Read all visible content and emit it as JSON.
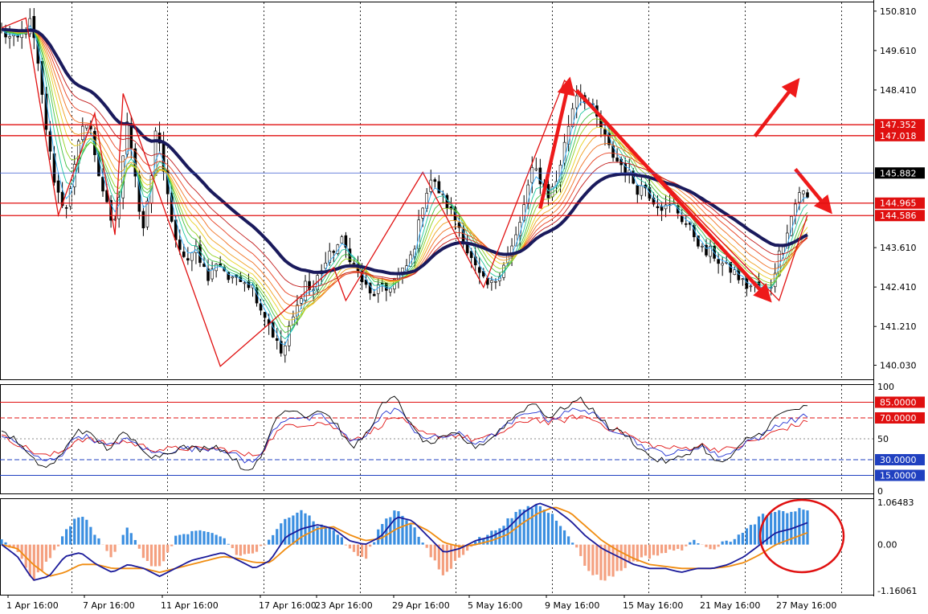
{
  "chart_data": [
    {
      "type": "candlestick",
      "title": "",
      "price_ticks": [
        "150.810",
        "149.610",
        "148.410",
        "147.352",
        "147.018",
        "145.882",
        "144.965",
        "144.586",
        "143.610",
        "142.410",
        "141.210",
        "140.030"
      ],
      "ylim": [
        139.6,
        151.1
      ],
      "date_ticks": [
        "1 Apr 16:00",
        "7 Apr 16:00",
        "11 Apr 16:00",
        "17 Apr 16:00",
        "23 Apr 16:00",
        "29 Apr 16:00",
        "5 May 16:00",
        "9 May 16:00",
        "15 May 16:00",
        "21 May 16:00",
        "27 May 16:00"
      ],
      "horizontal_levels": [
        {
          "value": 147.352,
          "label": "147.352",
          "color": "#e01010"
        },
        {
          "value": 147.018,
          "label": "147.018",
          "color": "#e01010"
        },
        {
          "value": 145.882,
          "label": "145.882",
          "color": "#3a5bd0",
          "current": true
        },
        {
          "value": 144.965,
          "label": "144.965",
          "color": "#e01010"
        },
        {
          "value": 144.586,
          "label": "144.586",
          "color": "#e01010"
        }
      ],
      "zigzag_points": [
        [
          0,
          150.3
        ],
        [
          4,
          150.6
        ],
        [
          10,
          144.6
        ],
        [
          16,
          147.7
        ],
        [
          20,
          144.0
        ],
        [
          21,
          148.3
        ],
        [
          38,
          140.0
        ],
        [
          58,
          143.0
        ],
        [
          60,
          142.0
        ],
        [
          73,
          145.9
        ],
        [
          84,
          142.4
        ],
        [
          98,
          148.7
        ],
        [
          135,
          142.0
        ],
        [
          140,
          144.6
        ]
      ],
      "key_close": [
        150.2,
        150.0,
        149.9,
        150.2,
        150.5,
        149.0,
        147.3,
        145.8,
        145.0,
        144.9,
        146.2,
        147.5,
        147.2,
        146.0,
        145.1,
        144.1,
        145.3,
        147.6,
        146.0,
        144.0,
        145.2,
        147.5,
        145.8,
        144.3,
        143.6,
        143.0,
        143.8,
        143.2,
        142.6,
        143.2,
        143.0,
        142.5,
        142.8,
        142.6,
        142.4,
        141.8,
        141.4,
        140.8,
        140.3,
        141.2,
        141.8,
        142.6,
        142.2,
        142.9,
        143.2,
        143.6,
        143.8,
        143.4,
        142.9,
        142.5,
        142.1,
        142.4,
        142.3,
        142.6,
        142.8,
        143.1,
        143.8,
        145.0,
        145.7,
        145.4,
        145.0,
        144.6,
        144.2,
        143.5,
        143.0,
        142.6,
        142.4,
        142.7,
        143.2,
        143.6,
        144.2,
        145.3,
        146.1,
        145.6,
        145.2,
        145.6,
        146.6,
        147.7,
        148.5,
        148.1,
        147.8,
        147.3,
        146.7,
        146.3,
        146.1,
        145.8,
        145.4,
        145.5,
        145.1,
        144.9,
        144.8,
        144.9,
        144.5,
        144.2,
        143.9,
        143.4,
        143.5,
        143.2,
        143.0,
        142.9,
        142.6,
        142.4,
        142.5,
        142.2,
        142.4,
        143.3,
        144.0,
        144.7,
        145.4,
        145.1
      ],
      "legend": "none",
      "grid": "vertical dotted"
    },
    {
      "type": "line",
      "name": "oscillator",
      "ylim": [
        0,
        100
      ],
      "y_ticks": [
        "100",
        "50",
        "0"
      ],
      "levels": [
        {
          "value": 85,
          "label": "85.0000",
          "color": "#e01010"
        },
        {
          "value": 70,
          "label": "70.0000",
          "color": "#e01010"
        },
        {
          "value": 30,
          "label": "30.0000",
          "color": "#2040c0"
        },
        {
          "value": 15,
          "label": "15.0000",
          "color": "#2040c0"
        }
      ],
      "series_colors": [
        "#000000",
        "#2030d0",
        "#e01010"
      ],
      "keys_fast": [
        58,
        48,
        30,
        22,
        35,
        60,
        52,
        40,
        55,
        45,
        32,
        38,
        42,
        40,
        44,
        35,
        20,
        28,
        70,
        80,
        72,
        78,
        65,
        40,
        55,
        82,
        90,
        60,
        45,
        50,
        55,
        42,
        48,
        62,
        75,
        85,
        70,
        80,
        88,
        76,
        60,
        55,
        40,
        30,
        28,
        35,
        45,
        26,
        32,
        50,
        55,
        72,
        78,
        80
      ],
      "keys_mid": [
        54,
        46,
        34,
        28,
        36,
        54,
        50,
        42,
        50,
        44,
        36,
        38,
        41,
        40,
        42,
        38,
        28,
        32,
        62,
        72,
        68,
        72,
        62,
        46,
        55,
        72,
        80,
        60,
        50,
        52,
        55,
        46,
        50,
        60,
        70,
        78,
        68,
        74,
        80,
        72,
        60,
        56,
        44,
        38,
        36,
        38,
        44,
        34,
        36,
        48,
        52,
        64,
        68,
        72
      ],
      "keys_slow": [
        52,
        46,
        38,
        33,
        38,
        50,
        49,
        44,
        48,
        44,
        40,
        40,
        41,
        40,
        41,
        39,
        34,
        36,
        55,
        64,
        64,
        66,
        60,
        50,
        54,
        64,
        72,
        60,
        53,
        53,
        54,
        49,
        51,
        57,
        64,
        70,
        65,
        68,
        72,
        68,
        60,
        56,
        47,
        43,
        41,
        41,
        44,
        40,
        40,
        46,
        50,
        58,
        62,
        66
      ]
    },
    {
      "type": "bar+line",
      "name": "macd",
      "ylim": [
        -1.16061,
        1.06483
      ],
      "y_ticks": [
        "1.06483",
        "0.00",
        "-1.16061"
      ],
      "positive_color": "#3a8ee0",
      "negative_color": "#f4a080",
      "line_colors": [
        "#1a1a9a",
        "#f08c10"
      ],
      "keys_hist": [
        0.1,
        -0.2,
        -0.9,
        -0.4,
        0.3,
        0.8,
        0.2,
        -0.3,
        0.5,
        -0.4,
        -0.6,
        0.2,
        0.3,
        0.3,
        0.2,
        -0.3,
        -0.2,
        0.1,
        0.7,
        0.9,
        0.5,
        0.4,
        -0.1,
        -0.4,
        0.5,
        0.9,
        0.5,
        -0.2,
        -0.8,
        -0.3,
        0.1,
        0.3,
        0.6,
        0.9,
        1.0,
        0.7,
        0.2,
        -0.6,
        -0.9,
        -0.7,
        -0.4,
        -0.3,
        -0.2,
        -0.1,
        0.1,
        -0.1,
        0.1,
        0.3,
        0.7,
        0.8,
        0.85,
        0.9
      ],
      "keys_line1": [
        0.0,
        -0.3,
        -0.9,
        -0.8,
        -0.3,
        -0.2,
        -0.5,
        -0.7,
        -0.5,
        -0.6,
        -0.8,
        -0.6,
        -0.4,
        -0.3,
        -0.2,
        -0.4,
        -0.6,
        -0.4,
        0.2,
        0.4,
        0.5,
        0.4,
        0.1,
        0.0,
        0.2,
        0.7,
        0.6,
        0.2,
        -0.2,
        -0.1,
        0.1,
        0.2,
        0.4,
        0.8,
        1.05,
        0.9,
        0.6,
        0.2,
        -0.1,
        -0.3,
        -0.5,
        -0.6,
        -0.6,
        -0.7,
        -0.6,
        -0.6,
        -0.5,
        -0.3,
        0.0,
        0.3,
        0.4,
        0.55
      ],
      "keys_line2": [
        0.0,
        -0.1,
        -0.5,
        -0.8,
        -0.7,
        -0.5,
        -0.5,
        -0.6,
        -0.6,
        -0.6,
        -0.7,
        -0.6,
        -0.5,
        -0.4,
        -0.3,
        -0.35,
        -0.45,
        -0.45,
        -0.1,
        0.2,
        0.4,
        0.45,
        0.25,
        0.1,
        0.15,
        0.4,
        0.55,
        0.35,
        0.05,
        -0.05,
        0.0,
        0.1,
        0.25,
        0.55,
        0.8,
        0.95,
        0.8,
        0.45,
        0.1,
        -0.15,
        -0.35,
        -0.5,
        -0.55,
        -0.6,
        -0.6,
        -0.6,
        -0.55,
        -0.45,
        -0.25,
        0.0,
        0.15,
        0.3
      ]
    }
  ]
}
